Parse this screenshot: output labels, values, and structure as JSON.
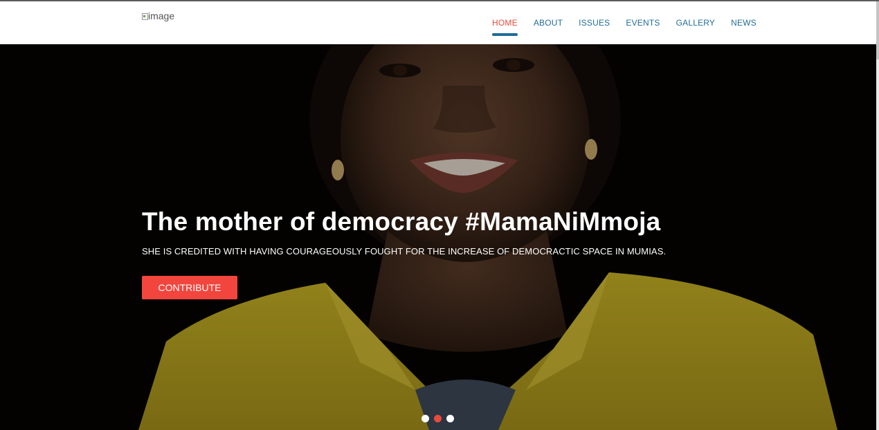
{
  "header": {
    "logo_alt": "image",
    "nav": [
      {
        "label": "HOME",
        "active": true
      },
      {
        "label": "ABOUT",
        "active": false
      },
      {
        "label": "ISSUES",
        "active": false
      },
      {
        "label": "EVENTS",
        "active": false
      },
      {
        "label": "GALLERY",
        "active": false
      },
      {
        "label": "NEWS",
        "active": false
      }
    ]
  },
  "hero": {
    "title": "The mother of democracy #MamaNiMmoja",
    "subtitle": "SHE IS CREDITED WITH HAVING COURAGEOUSLY FOUGHT FOR THE INCREASE OF DEMOCRACTIC SPACE IN MUMIAS.",
    "button_label": "CONTRIBUTE",
    "slides": 3,
    "active_slide": 2
  },
  "colors": {
    "accent_red": "#e84a3c",
    "button_red": "#f2453d",
    "nav_blue": "#1f6c99",
    "jacket_yellow": "#d8c22a"
  }
}
